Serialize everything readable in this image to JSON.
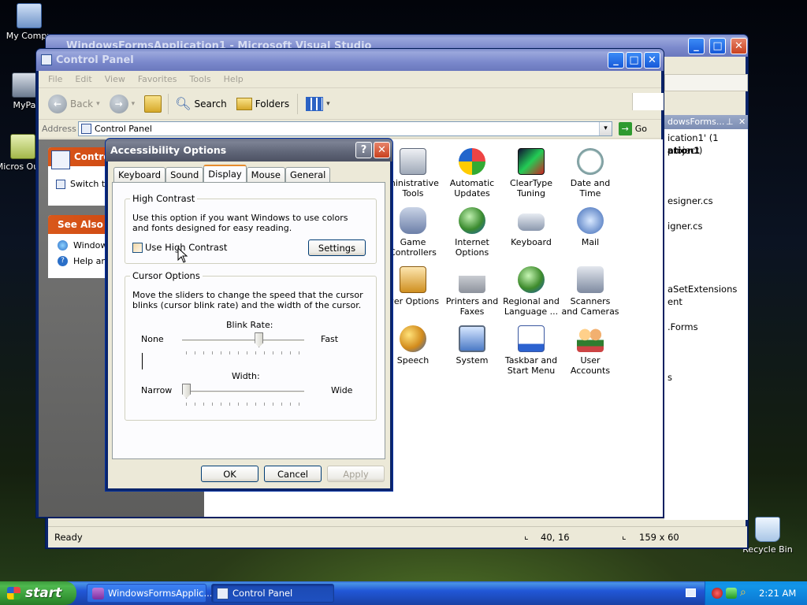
{
  "desktop": {
    "icons": [
      {
        "label": "My Compu"
      },
      {
        "label": "MyPa"
      },
      {
        "label": "Micros Outlo"
      },
      {
        "label": "Recycle Bin"
      }
    ]
  },
  "vs_window": {
    "title": "WindowsFormsApplication1 - Microsoft Visual Studio",
    "solution_panel_title": "dowsForms...",
    "solution_items": [
      "ication1' (1 project)",
      "ation1",
      "esigner.cs",
      "igner.cs",
      "aSetExtensions",
      "ent",
      ".Forms",
      "s"
    ],
    "status": {
      "ready": "Ready",
      "position": "40, 16",
      "size": "159 x 60"
    }
  },
  "control_panel": {
    "title": "Control Panel",
    "menu": [
      "File",
      "Edit",
      "View",
      "Favorites",
      "Tools",
      "Help"
    ],
    "toolbar": {
      "back": "Back",
      "search": "Search",
      "folders": "Folders"
    },
    "address_label": "Address",
    "address_value": "Control Panel",
    "go_label": "Go",
    "sidebar": {
      "task_title": "Contro",
      "task_link": "Switch t",
      "see_also_title": "See Also",
      "see_also_items": [
        "Window",
        "Help an"
      ]
    },
    "icons": [
      {
        "label": "ministrative Tools"
      },
      {
        "label": "Automatic Updates"
      },
      {
        "label": "ClearType Tuning"
      },
      {
        "label": "Date and Time"
      },
      {
        "label": "Game Controllers"
      },
      {
        "label": "Internet Options"
      },
      {
        "label": "Keyboard"
      },
      {
        "label": "Mail"
      },
      {
        "label": "wer Options"
      },
      {
        "label": "Printers and Faxes"
      },
      {
        "label": "Regional and Language ..."
      },
      {
        "label": "Scanners and Cameras"
      },
      {
        "label": "Speech"
      },
      {
        "label": "System"
      },
      {
        "label": "Taskbar and Start Menu"
      },
      {
        "label": "User Accounts"
      }
    ]
  },
  "dialog": {
    "title": "Accessibility Options",
    "help_btn": "?",
    "tabs": [
      "Keyboard",
      "Sound",
      "Display",
      "Mouse",
      "General"
    ],
    "selected_tab": "Display",
    "high_contrast": {
      "group_label": "High Contrast",
      "description": "Use this option if you want Windows to use colors and fonts designed for easy reading.",
      "checkbox_label": "Use High Contrast",
      "checked": false,
      "settings_button": "Settings"
    },
    "cursor_options": {
      "group_label": "Cursor Options",
      "description": "Move the sliders to change the speed that the cursor blinks (cursor blink rate) and the width of the cursor.",
      "blink_rate_label": "Blink Rate:",
      "blink_min": "None",
      "blink_max": "Fast",
      "blink_value": 0.64,
      "width_label": "Width:",
      "width_min": "Narrow",
      "width_max": "Wide",
      "width_value": 0.0
    },
    "buttons": {
      "ok": "OK",
      "cancel": "Cancel",
      "apply": "Apply"
    }
  },
  "taskbar": {
    "start": "start",
    "tasks": [
      {
        "label": "WindowsFormsApplic...",
        "active": false
      },
      {
        "label": "Control Panel",
        "active": true
      }
    ],
    "clock": "2:21 AM"
  }
}
